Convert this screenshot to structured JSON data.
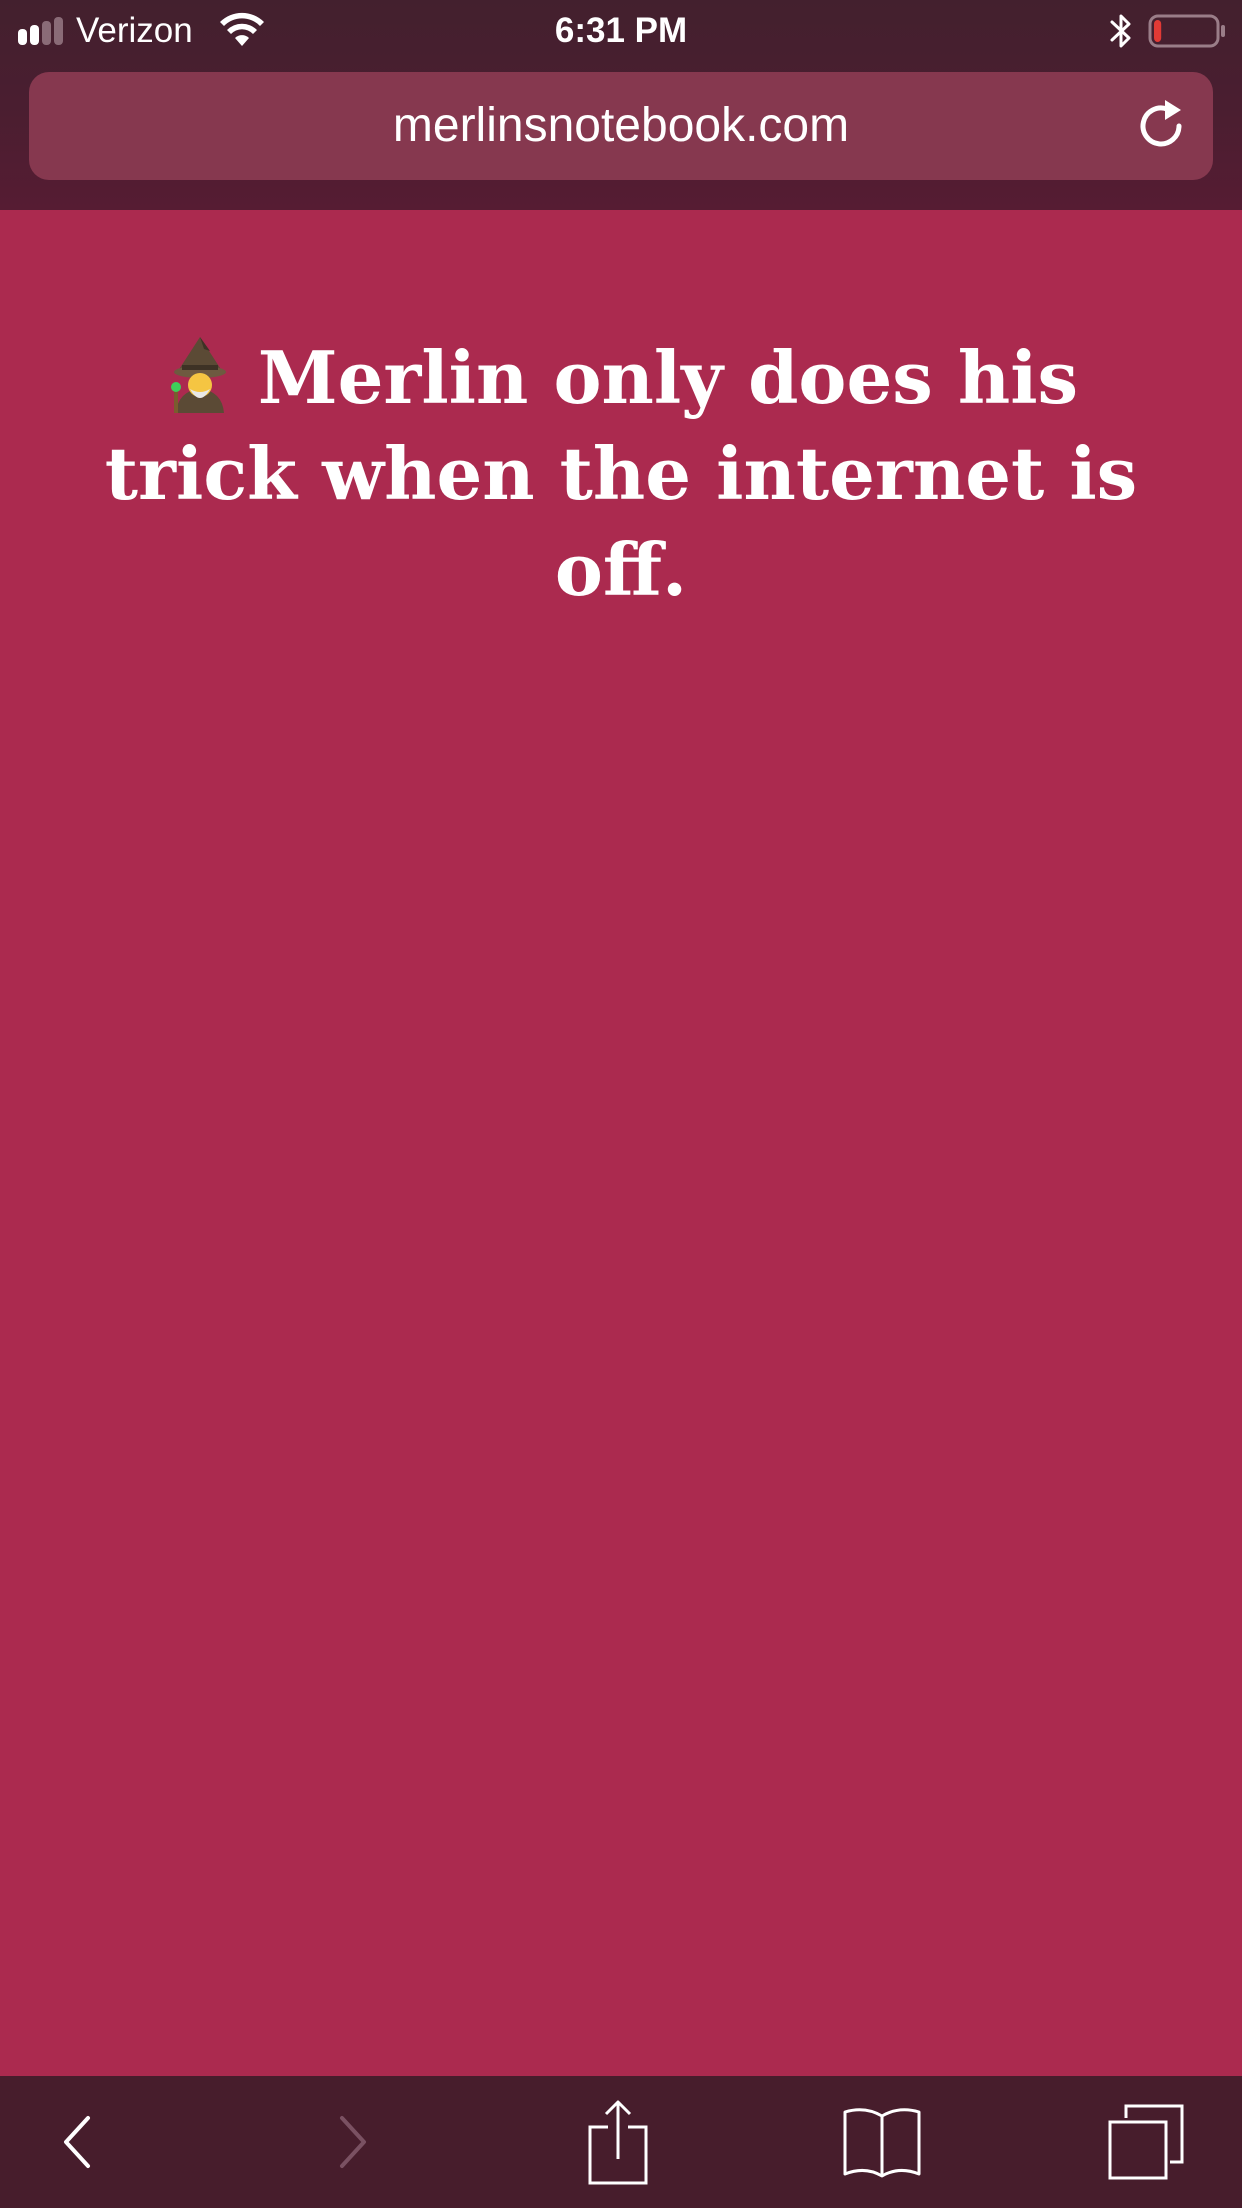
{
  "status_bar": {
    "carrier": "Verizon",
    "time": "6:31 PM",
    "signal_bars_filled": 2,
    "signal_bars_total": 4,
    "battery_level": 0.12,
    "battery_color": "#e23a35",
    "icons": [
      "signal-icon",
      "wifi-icon",
      "bluetooth-icon",
      "battery-icon"
    ]
  },
  "address_bar": {
    "url": "merlinsnotebook.com",
    "reload_icon": "reload-icon"
  },
  "page": {
    "emoji": "wizard-emoji",
    "message": "Merlin only does his trick when the internet is off.",
    "background_color": "#ab2a4f"
  },
  "toolbar": {
    "items": [
      {
        "icon": "back-icon",
        "enabled": true
      },
      {
        "icon": "forward-icon",
        "enabled": false
      },
      {
        "icon": "share-icon",
        "enabled": true
      },
      {
        "icon": "bookmarks-icon",
        "enabled": true
      },
      {
        "icon": "tabs-icon",
        "enabled": true
      }
    ]
  }
}
